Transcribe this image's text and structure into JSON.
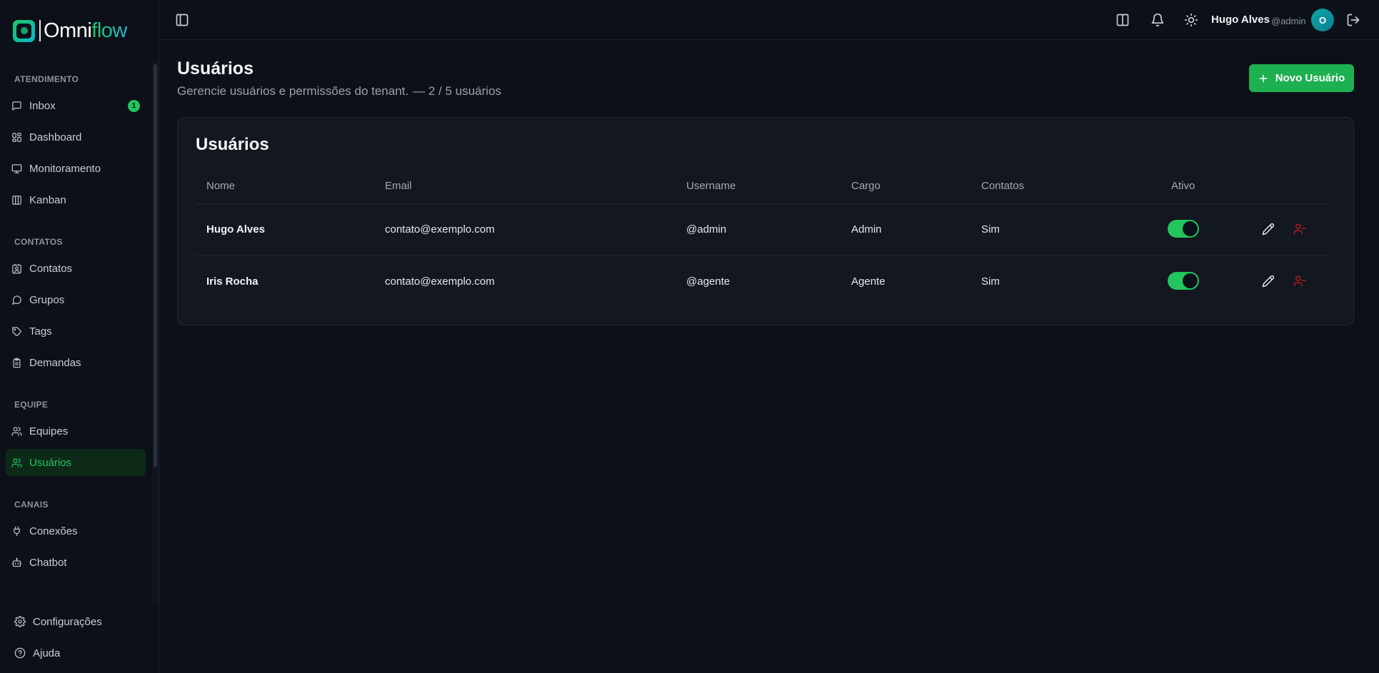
{
  "brand": {
    "name_prefix": "Omni",
    "name_suffix": "flow"
  },
  "sidebar": {
    "sections": [
      {
        "label": "ATENDIMENTO"
      },
      {
        "label": "CONTATOS"
      },
      {
        "label": "EQUIPE"
      },
      {
        "label": "CANAIS"
      }
    ],
    "items": [
      {
        "label": "Inbox",
        "icon": "message-square-icon",
        "badge": "1"
      },
      {
        "label": "Dashboard",
        "icon": "layout-dashboard-icon"
      },
      {
        "label": "Monitoramento",
        "icon": "monitor-icon"
      },
      {
        "label": "Kanban",
        "icon": "kanban-columns-icon"
      },
      {
        "label": "Contatos",
        "icon": "contact-icon"
      },
      {
        "label": "Grupos",
        "icon": "message-circle-icon"
      },
      {
        "label": "Tags",
        "icon": "tag-icon"
      },
      {
        "label": "Demandas",
        "icon": "clipboard-icon"
      },
      {
        "label": "Equipes",
        "icon": "users-icon"
      },
      {
        "label": "Usuários",
        "icon": "users-icon",
        "active": true
      },
      {
        "label": "Conexões",
        "icon": "plug-icon"
      },
      {
        "label": "Chatbot",
        "icon": "bot-icon"
      }
    ],
    "bottom": [
      {
        "label": "Configurações",
        "icon": "gear-icon"
      },
      {
        "label": "Ajuda",
        "icon": "help-circle-icon"
      }
    ]
  },
  "header": {
    "user_name": "Hugo Alves",
    "user_handle": "@admin",
    "avatar_initial": "O"
  },
  "page": {
    "title": "Usuários",
    "subtitle": "Gerencie usuários e permissões do tenant.",
    "count": "— 2 / 5 usuários",
    "new_button": "Novo Usuário"
  },
  "table": {
    "title": "Usuários",
    "columns": [
      "Nome",
      "Email",
      "Username",
      "Cargo",
      "Contatos",
      "Ativo"
    ],
    "rows": [
      {
        "nome": "Hugo Alves",
        "email": "contato@exemplo.com",
        "username": "@admin",
        "cargo": "Admin",
        "contatos": "Sim",
        "ativo": true
      },
      {
        "nome": "Iris Rocha",
        "email": "contato@exemplo.com",
        "username": "@agente",
        "cargo": "Agente",
        "contatos": "Sim",
        "ativo": true
      }
    ]
  },
  "colors": {
    "accent": "#22c55e",
    "background": "#0c1018",
    "card": "#121720",
    "danger": "#dc2626"
  }
}
